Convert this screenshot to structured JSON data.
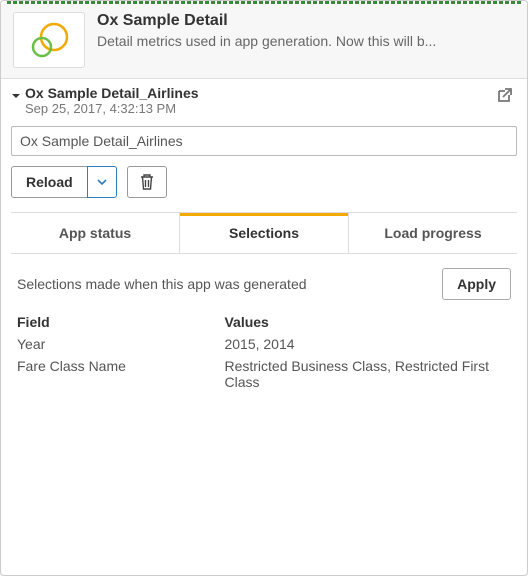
{
  "header": {
    "title": "Ox Sample Detail",
    "description": "Detail metrics used in app generation. Now this will b..."
  },
  "sub": {
    "title": "Ox Sample Detail_Airlines",
    "timestamp": "Sep 25, 2017, 4:32:13 PM"
  },
  "name_input": {
    "value": "Ox Sample Detail_Airlines"
  },
  "toolbar": {
    "reload_label": "Reload"
  },
  "tabs": {
    "app_status": "App status",
    "selections": "Selections",
    "load_progress": "Load progress"
  },
  "selections": {
    "description": "Selections made when this app was generated",
    "apply_label": "Apply",
    "field_header": "Field",
    "values_header": "Values",
    "rows": [
      {
        "field": "Year",
        "values": "2015, 2014"
      },
      {
        "field": "Fare Class Name",
        "values": "Restricted Business Class, Restricted First Class"
      }
    ]
  },
  "colors": {
    "accent": "#f2a900",
    "logo_ring1": "#f2a900",
    "logo_ring2": "#6bbf47"
  }
}
